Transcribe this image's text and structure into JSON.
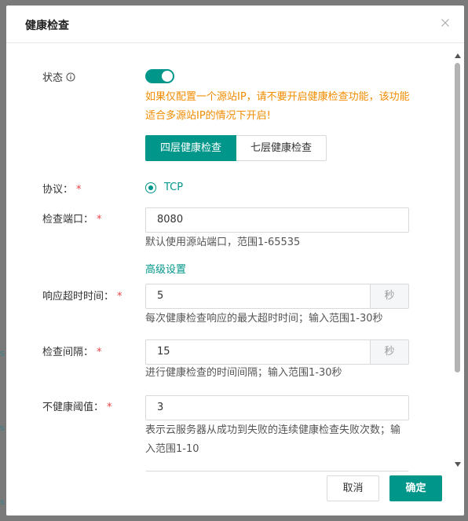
{
  "dialog": {
    "title": "健康检查"
  },
  "form": {
    "status": {
      "label": "状态",
      "enabled": true,
      "warning": "如果仅配置一个源站IP，请不要开启健康检查功能，该功能适合多源站IP的情况下开启!"
    },
    "layer_tabs": [
      {
        "label": "四层健康检查",
        "active": true
      },
      {
        "label": "七层健康检查",
        "active": false
      }
    ],
    "protocol": {
      "label": "协议：",
      "option": "TCP",
      "selected": true
    },
    "port": {
      "label": "检查端口：",
      "value": "8080",
      "hint": "默认使用源站端口，范围1-65535"
    },
    "advanced_link": "高级设置",
    "timeout": {
      "label": "响应超时时间：",
      "value": "5",
      "unit": "秒",
      "hint": "每次健康检查响应的最大超时时间；输入范围1-30秒"
    },
    "interval": {
      "label": "检查间隔：",
      "value": "15",
      "unit": "秒",
      "hint": "进行健康检查的时间间隔；输入范围1-30秒"
    },
    "unhealthy_threshold": {
      "label": "不健康阈值：",
      "value": "3",
      "hint": "表示云服务器从成功到失败的连续健康检查失败次数；输入范围1-10"
    },
    "required_mark": "*"
  },
  "footer": {
    "cancel_label": "取消",
    "ok_label": "确定"
  },
  "colors": {
    "accent": "#00968a",
    "warning": "#f08c00",
    "required": "#e64545"
  }
}
